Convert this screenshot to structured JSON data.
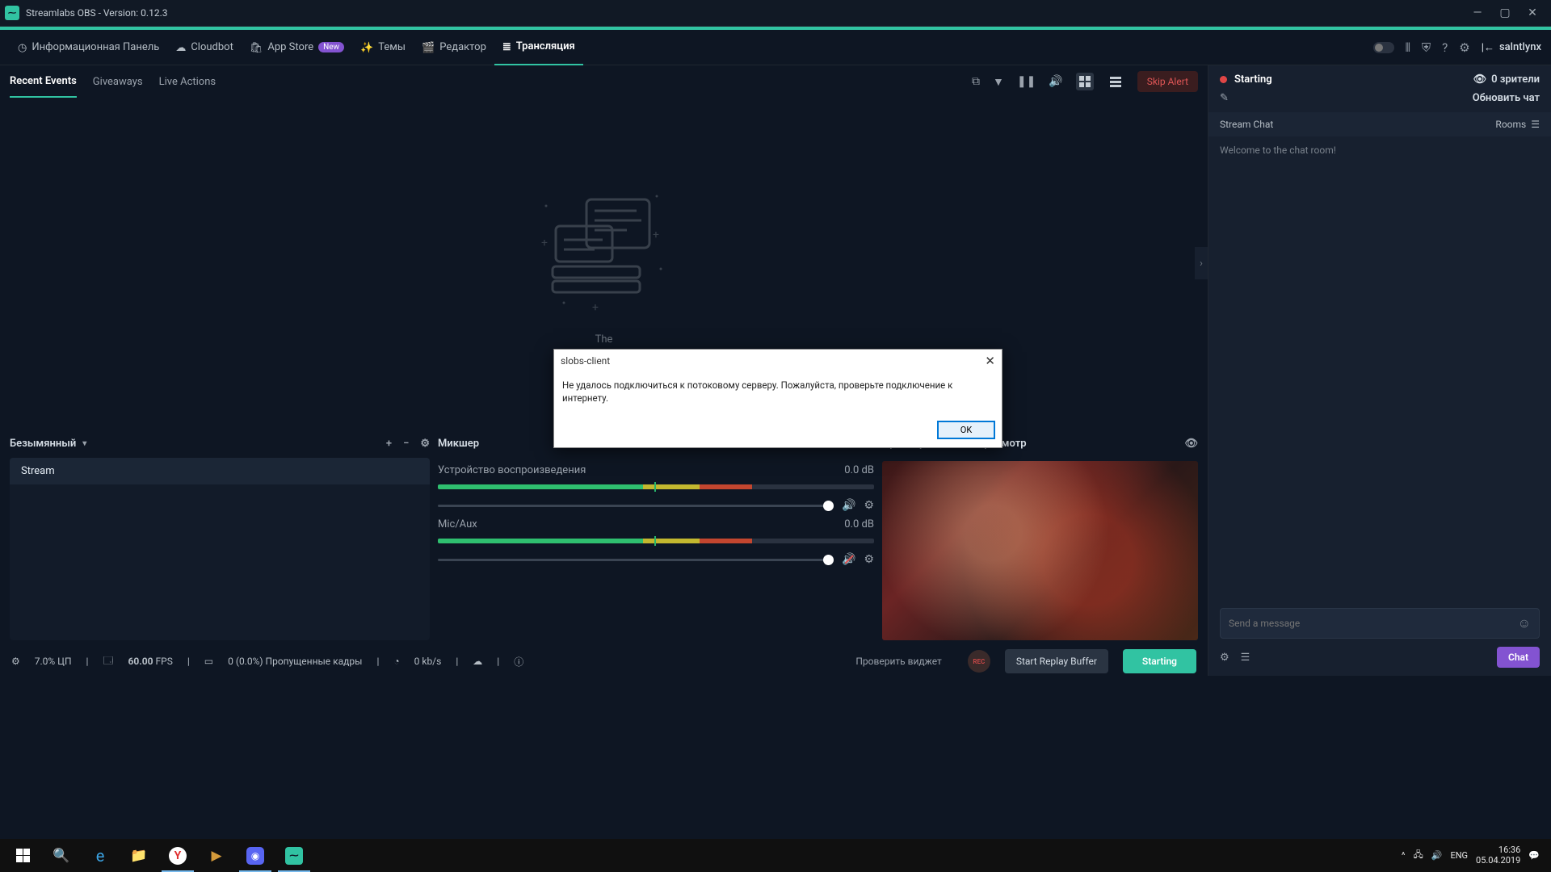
{
  "window": {
    "title": "Streamlabs OBS - Version: 0.12.3"
  },
  "nav": {
    "dashboard": "Информационная Панель",
    "cloudbot": "Cloudbot",
    "appstore": "App Store",
    "appstore_badge": "New",
    "themes": "Темы",
    "editor": "Редактор",
    "live": "Трансляция",
    "username": "salntlynx"
  },
  "subtabs": {
    "recent": "Recent Events",
    "giveaways": "Giveaways",
    "liveactions": "Live Actions",
    "skipalert": "Skip Alert"
  },
  "empty": {
    "text": "The"
  },
  "scene": {
    "title": "Безымянный",
    "source": "Stream"
  },
  "mixer": {
    "title": "Микшер",
    "items": [
      {
        "name": "Устройство воспроизведения",
        "db": "0.0 dB",
        "muted": false
      },
      {
        "name": "Mic/Aux",
        "db": "0.0 dB",
        "muted": true
      }
    ]
  },
  "preview": {
    "title": "Предварительный Просмотр"
  },
  "status": {
    "cpu": "7.0% ЦП",
    "fps_num": "60.00",
    "fps_lbl": "FPS",
    "dropped": "0 (0.0%) Пропущенные кадры",
    "bitrate": "0 kb/s",
    "checkwidget": "Проверить виджет",
    "rec": "REC",
    "replay": "Start Replay Buffer",
    "golive": "Starting"
  },
  "side": {
    "status": "Starting",
    "viewers": "0 зрители",
    "refresh": "Обновить чат",
    "chat_title": "Stream Chat",
    "rooms": "Rooms",
    "welcome": "Welcome to the chat room!",
    "placeholder": "Send a message",
    "chat_btn": "Chat"
  },
  "dialog": {
    "title": "slobs-client",
    "body": "Не удалось подключиться к потоковому серверу. Пожалуйста, проверьте подключение к интернету.",
    "ok": "OK"
  },
  "tray": {
    "lang": "ENG",
    "time": "16:36",
    "date": "05.04.2019"
  }
}
